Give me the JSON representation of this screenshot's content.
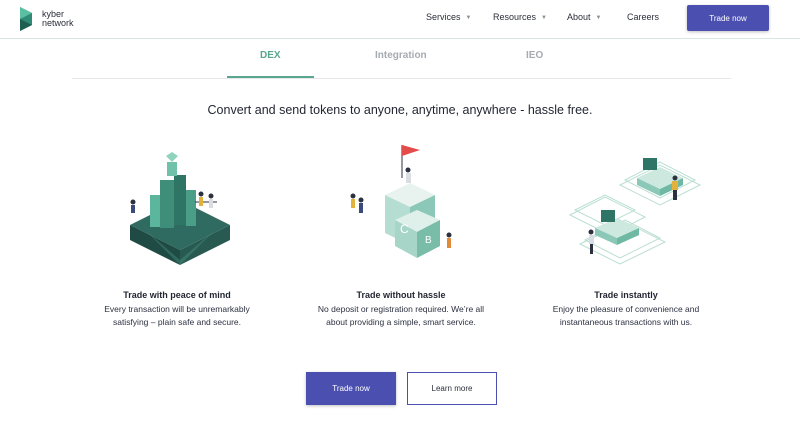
{
  "header": {
    "logo_line1": "kyber",
    "logo_line2": "network",
    "nav": [
      {
        "label": "Services"
      },
      {
        "label": "Resources"
      },
      {
        "label": "About"
      },
      {
        "label": "Careers"
      }
    ],
    "cta": "Trade now"
  },
  "tabs": [
    {
      "label": "DEX",
      "active": true
    },
    {
      "label": "Integration",
      "active": false
    },
    {
      "label": "IEO",
      "active": false
    }
  ],
  "headline": "Convert and send tokens to anyone, anytime, anywhere - hassle free.",
  "features": [
    {
      "title": "Trade with peace of mind",
      "desc": "Every transaction will be unremarkably satisfying – plain safe and secure."
    },
    {
      "title": "Trade without hassle",
      "desc": "No deposit or registration required. We’re all about providing a simple, smart service."
    },
    {
      "title": "Trade instantly",
      "desc": "Enjoy the pleasure of convenience and instantaneous transactions with us."
    }
  ],
  "buttons": {
    "trade_now": "Trade now",
    "learn_more": "Learn more"
  },
  "colors": {
    "accent": "#4a4fb0",
    "tab_active": "#5aa68e",
    "tab_inactive": "#a6abb1"
  }
}
